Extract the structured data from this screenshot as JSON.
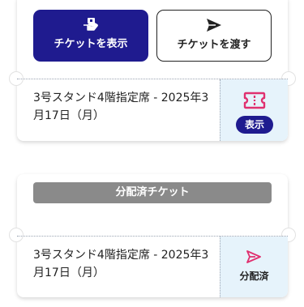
{
  "tickets": [
    {
      "status": "active",
      "show_button_label": "チケットを表示",
      "pass_button_label": "チケットを渡す",
      "seat_info": "3号スタンド4階指定席 - 2025年3月17日（月）",
      "side_badge_label": "表示"
    },
    {
      "status": "distributed",
      "banner_label": "分配済チケット",
      "seat_info": "3号スタンド4階指定席 - 2025年3月17日（月）",
      "side_label": "分配済"
    }
  ],
  "colors": {
    "primary": "#1f1b8f",
    "ticket_icon": "#e0306f",
    "side_panel": "#e6f3fb",
    "distributed_banner": "#8a8a8a"
  },
  "icons": {
    "show": "hand-ticket-icon",
    "pass": "send-icon",
    "ticket": "ticket-icon",
    "distributed": "send-icon"
  }
}
